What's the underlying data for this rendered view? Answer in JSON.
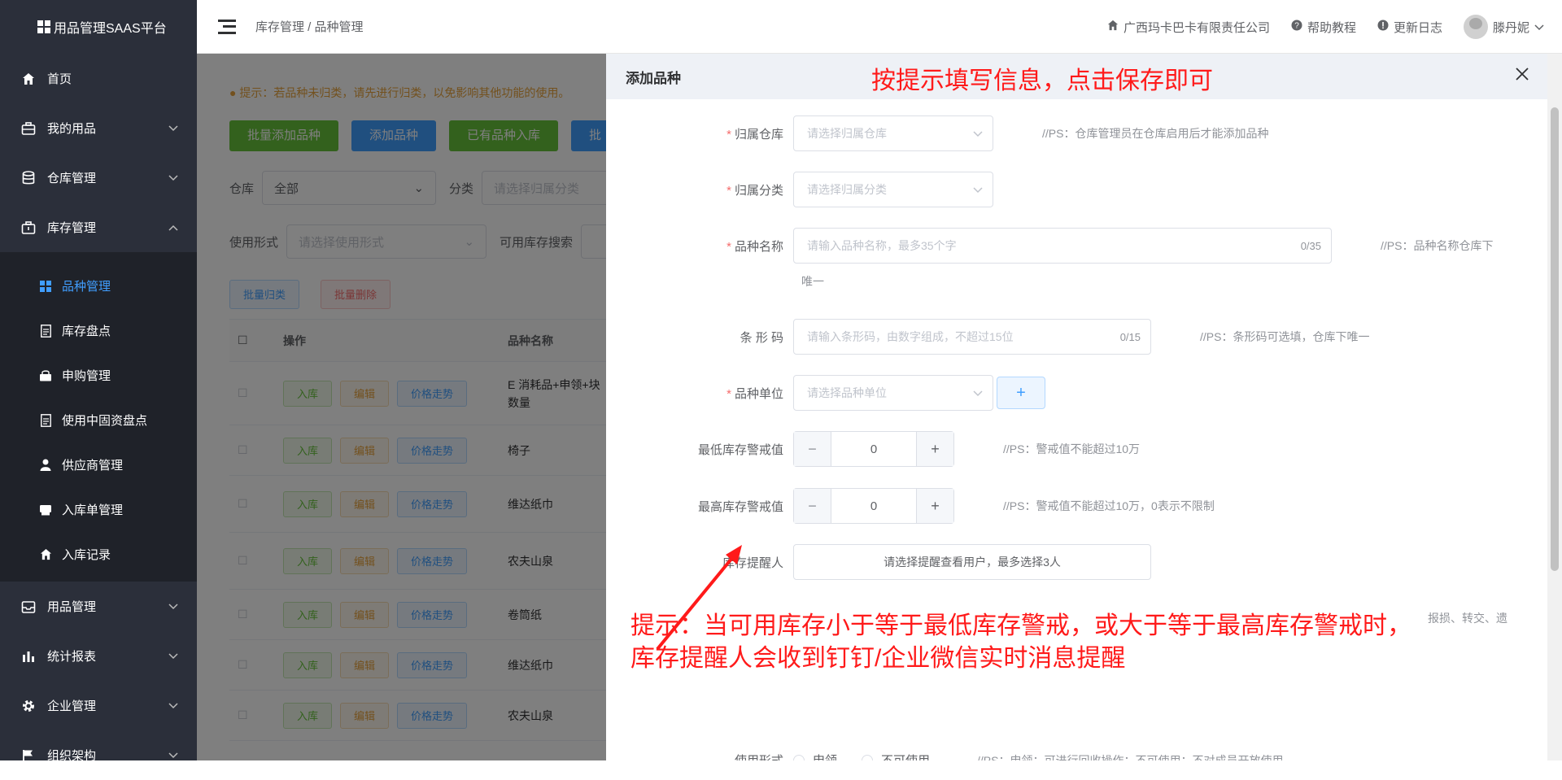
{
  "app": {
    "brand": "用品管理SAAS平台"
  },
  "sidebar": {
    "items": [
      {
        "label": "首页",
        "icon": "home-icon"
      },
      {
        "label": "我的用品",
        "icon": "box-icon"
      },
      {
        "label": "仓库管理",
        "icon": "database-icon"
      },
      {
        "label": "库存管理",
        "icon": "briefcase-icon"
      }
    ],
    "submenu": [
      {
        "label": "品种管理",
        "icon": "grid-icon"
      },
      {
        "label": "库存盘点",
        "icon": "document-icon"
      },
      {
        "label": "申购管理",
        "icon": "bag-icon"
      },
      {
        "label": "使用中固资盘点",
        "icon": "document-icon"
      },
      {
        "label": "供应商管理",
        "icon": "user-icon"
      },
      {
        "label": "入库单管理",
        "icon": "printer-icon"
      },
      {
        "label": "入库记录",
        "icon": "home-icon"
      }
    ],
    "items_after": [
      {
        "label": "用品管理",
        "icon": "inbox-icon"
      },
      {
        "label": "统计报表",
        "icon": "bar-chart-icon"
      },
      {
        "label": "企业管理",
        "icon": "gear-icon"
      },
      {
        "label": "组织架构",
        "icon": "flag-icon"
      }
    ]
  },
  "header": {
    "breadcrumb": "库存管理 / 品种管理",
    "company": "广西玛卡巴卡有限责任公司",
    "help": "帮助教程",
    "changelog": "更新日志",
    "user": "滕丹妮"
  },
  "main": {
    "notice": "提示：若品种未归类，请先进行归类，以免影响其他功能的使用。",
    "buttons": {
      "batch_add": "批量添加品种",
      "add": "添加品种",
      "stock_in": "已有品种入库",
      "more": "批"
    },
    "filters": {
      "warehouse_label": "仓库",
      "warehouse_value": "全部",
      "category_label": "分类",
      "category_placeholder": "请选择归属分类",
      "usage_label": "使用形式",
      "usage_placeholder": "请选择使用形式",
      "stock_label": "可用库存搜索"
    },
    "batch": {
      "classify": "批量归类",
      "delete": "批量删除"
    },
    "table": {
      "headers": [
        "操作",
        "品种名称"
      ],
      "row_actions": {
        "in": "入库",
        "edit": "编辑",
        "price": "价格走势"
      },
      "rows": [
        "E 消耗品+申领+块数量",
        "椅子",
        "维达纸巾",
        "农夫山泉",
        "卷筒纸",
        "维达纸巾",
        "农夫山泉"
      ]
    }
  },
  "drawer": {
    "title": "添加品种",
    "annotation_top": "按提示填写信息，点击保存即可",
    "form": {
      "warehouse": {
        "label": "归属仓库",
        "placeholder": "请选择归属仓库",
        "hint": "//PS：仓库管理员在仓库启用后才能添加品种"
      },
      "category": {
        "label": "归属分类",
        "placeholder": "请选择归属分类"
      },
      "name": {
        "label": "品种名称",
        "placeholder": "请输入品种名称，最多35个字",
        "count": "0/35",
        "hint": "//PS：品种名称仓库下",
        "hint2": "唯一"
      },
      "barcode": {
        "label": "条 形 码",
        "placeholder": "请输入条形码，由数字组成，不超过15位",
        "count": "0/15",
        "hint": "//PS：条形码可选填，仓库下唯一"
      },
      "unit": {
        "label": "品种单位",
        "placeholder": "请选择品种单位"
      },
      "min_stock": {
        "label": "最低库存警戒值",
        "value": "0",
        "hint": "//PS：警戒值不能超过10万"
      },
      "max_stock": {
        "label": "最高库存警戒值",
        "value": "0",
        "hint": "//PS：警戒值不能超过10万，0表示不限制"
      },
      "reminder": {
        "label": "库存提醒人",
        "button": "请选择提醒查看用户，最多选择3人"
      },
      "hidden_row_tail": "报损、转交、遗",
      "usage": {
        "label": "使用形式",
        "opt1": "申领",
        "opt2": "不可使用",
        "hint": "//PS：申领：可进行回收操作；不可使用：不对成员开放使用"
      }
    },
    "annotation_bottom_1": "提示：当可用库存小于等于最低库存警戒，或大于等于最高库存警戒时，",
    "annotation_bottom_2": "库存提醒人会收到钉钉/企业微信实时消息提醒"
  }
}
